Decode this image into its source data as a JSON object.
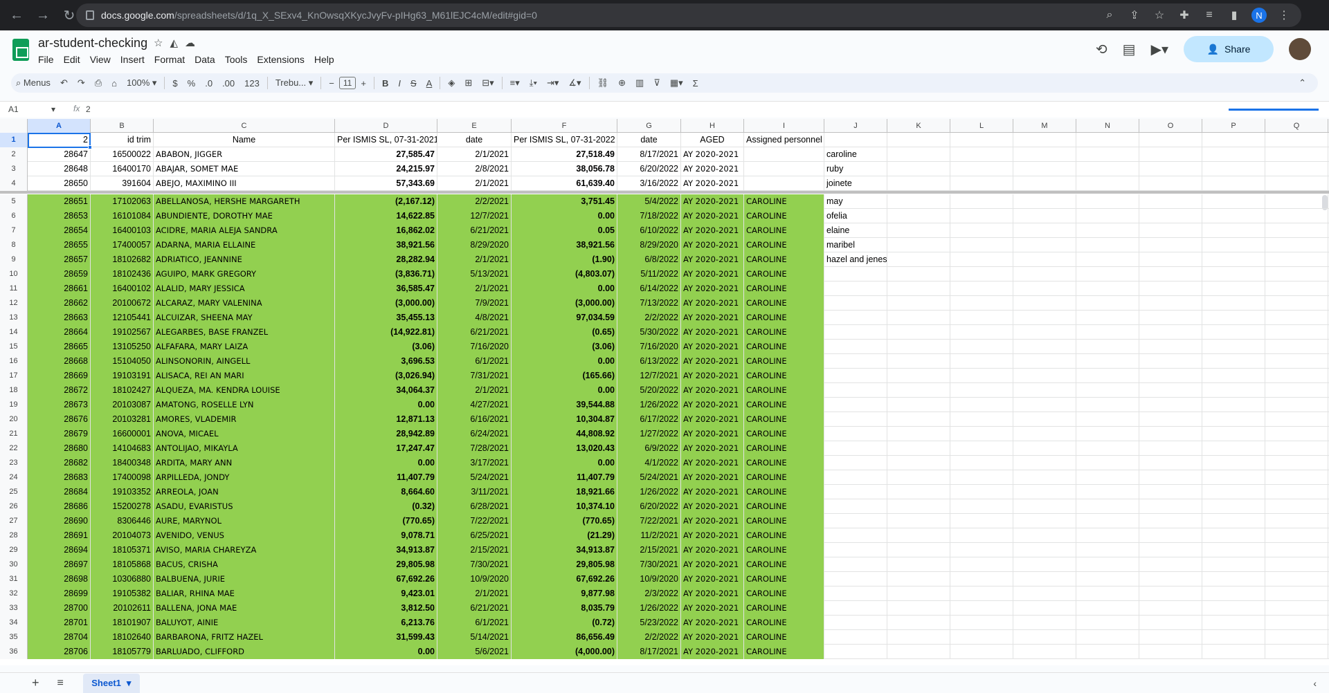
{
  "browser": {
    "url_host": "docs.google.com",
    "url_path": "/spreadsheets/d/1q_X_SExv4_KnOwsqXKycJvyFv-pIHg63_M61lEJC4cM/edit#gid=0",
    "avatar_letter": "N"
  },
  "doc": {
    "title": "ar-student-checking",
    "menus": [
      "File",
      "Edit",
      "View",
      "Insert",
      "Format",
      "Data",
      "Tools",
      "Extensions",
      "Help"
    ],
    "share_label": "Share"
  },
  "toolbar": {
    "search_label": "Menus",
    "zoom": "100%",
    "currency": "$",
    "percent": "%",
    "dec_less": ".0",
    "dec_more": ".00",
    "format_123": "123",
    "font": "Trebu...",
    "font_size": "11",
    "bold": "B",
    "italic": "I",
    "strike": "S",
    "textcolor": "A"
  },
  "formula_bar": {
    "cell_ref": "A1",
    "fx": "fx",
    "value": "2"
  },
  "columns": [
    "A",
    "B",
    "C",
    "D",
    "E",
    "F",
    "G",
    "H",
    "I",
    "J",
    "K",
    "L",
    "M",
    "N",
    "O",
    "P",
    "Q"
  ],
  "header_row": [
    "2",
    "id trim",
    "Name",
    "Per ISMIS SL, 07-31-2021",
    "date",
    "Per ISMIS SL, 07-31-2022",
    "date",
    "AGED",
    "Assigned personnel",
    "",
    "",
    "",
    "",
    "",
    "",
    "",
    ""
  ],
  "rows": [
    [
      "28647",
      "16500022",
      "ABABON, JIGGER",
      "27,585.47",
      "2/1/2021",
      "27,518.49",
      "8/17/2021",
      "AY 2020-2021",
      "",
      "caroline"
    ],
    [
      "28648",
      "16400170",
      "ABAJAR, SOMET MAE",
      "24,215.97",
      "2/8/2021",
      "38,056.78",
      "6/20/2022",
      "AY 2020-2021",
      "",
      "ruby"
    ],
    [
      "28650",
      "391604",
      "ABEJO, MAXIMINO III",
      "57,343.69",
      "2/1/2021",
      "61,639.40",
      "3/16/2022",
      "AY 2020-2021",
      "",
      "joinete"
    ],
    [
      "28651",
      "17102063",
      "ABELLANOSA, HERSHE MARGARETH",
      "(2,167.12)",
      "2/2/2021",
      "3,751.45",
      "5/4/2022",
      "AY 2020-2021",
      "CAROLINE",
      "may"
    ],
    [
      "28653",
      "16101084",
      "ABUNDIENTE, DOROTHY MAE",
      "14,622.85",
      "12/7/2021",
      "0.00",
      "7/18/2022",
      "AY 2020-2021",
      "CAROLINE",
      "ofelia"
    ],
    [
      "28654",
      "16400103",
      "ACIDRE, MARIA ALEJA SANDRA",
      "16,862.02",
      "6/21/2021",
      "0.05",
      "6/10/2022",
      "AY 2020-2021",
      "CAROLINE",
      "elaine"
    ],
    [
      "28655",
      "17400057",
      "ADARNA, MARIA ELLAINE",
      "38,921.56",
      "8/29/2020",
      "38,921.56",
      "8/29/2020",
      "AY 2020-2021",
      "CAROLINE",
      "maribel"
    ],
    [
      "28657",
      "18102682",
      "ADRIATICO, JEANNINE",
      "28,282.94",
      "2/1/2021",
      "(1.90)",
      "6/8/2022",
      "AY 2020-2021",
      "CAROLINE",
      "hazel and jenesel"
    ],
    [
      "28659",
      "18102436",
      "AGUIPO, MARK GREGORY",
      "(3,836.71)",
      "5/13/2021",
      "(4,803.07)",
      "5/11/2022",
      "AY 2020-2021",
      "CAROLINE",
      ""
    ],
    [
      "28661",
      "16400102",
      "ALALID, MARY JESSICA",
      "36,585.47",
      "2/1/2021",
      "0.00",
      "6/14/2022",
      "AY 2020-2021",
      "CAROLINE",
      ""
    ],
    [
      "28662",
      "20100672",
      "ALCARAZ, MARY VALENINA",
      "(3,000.00)",
      "7/9/2021",
      "(3,000.00)",
      "7/13/2022",
      "AY 2020-2021",
      "CAROLINE",
      ""
    ],
    [
      "28663",
      "12105441",
      "ALCUIZAR, SHEENA MAY",
      "35,455.13",
      "4/8/2021",
      "97,034.59",
      "2/2/2022",
      "AY 2020-2021",
      "CAROLINE",
      ""
    ],
    [
      "28664",
      "19102567",
      "ALEGARBES, BASE FRANZEL",
      "(14,922.81)",
      "6/21/2021",
      "(0.65)",
      "5/30/2022",
      "AY 2020-2021",
      "CAROLINE",
      ""
    ],
    [
      "28665",
      "13105250",
      "ALFAFARA, MARY LAIZA",
      "(3.06)",
      "7/16/2020",
      "(3.06)",
      "7/16/2020",
      "AY 2020-2021",
      "CAROLINE",
      ""
    ],
    [
      "28668",
      "15104050",
      "ALINSONORIN, AINGELL",
      "3,696.53",
      "6/1/2021",
      "0.00",
      "6/13/2022",
      "AY 2020-2021",
      "CAROLINE",
      ""
    ],
    [
      "28669",
      "19103191",
      "ALISACA, REI AN MARI",
      "(3,026.94)",
      "7/31/2021",
      "(165.66)",
      "12/7/2021",
      "AY 2020-2021",
      "CAROLINE",
      ""
    ],
    [
      "28672",
      "18102427",
      "ALQUEZA, MA. KENDRA LOUISE",
      "34,064.37",
      "2/1/2021",
      "0.00",
      "5/20/2022",
      "AY 2020-2021",
      "CAROLINE",
      ""
    ],
    [
      "28673",
      "20103087",
      "AMATONG, ROSELLE LYN",
      "0.00",
      "4/27/2021",
      "39,544.88",
      "1/26/2022",
      "AY 2020-2021",
      "CAROLINE",
      ""
    ],
    [
      "28676",
      "20103281",
      "AMORES, VLADEMIR",
      "12,871.13",
      "6/16/2021",
      "10,304.87",
      "6/17/2022",
      "AY 2020-2021",
      "CAROLINE",
      ""
    ],
    [
      "28679",
      "16600001",
      "ANOVA, MICAEL",
      "28,942.89",
      "6/24/2021",
      "44,808.92",
      "1/27/2022",
      "AY 2020-2021",
      "CAROLINE",
      ""
    ],
    [
      "28680",
      "14104683",
      "ANTOLIJAO, MIKAYLA",
      "17,247.47",
      "7/28/2021",
      "13,020.43",
      "6/9/2022",
      "AY 2020-2021",
      "CAROLINE",
      ""
    ],
    [
      "28682",
      "18400348",
      "ARDITA, MARY ANN",
      "0.00",
      "3/17/2021",
      "0.00",
      "4/1/2022",
      "AY 2020-2021",
      "CAROLINE",
      ""
    ],
    [
      "28683",
      "17400098",
      "ARPILLEDA, JONDY",
      "11,407.79",
      "5/24/2021",
      "11,407.79",
      "5/24/2021",
      "AY 2020-2021",
      "CAROLINE",
      ""
    ],
    [
      "28684",
      "19103352",
      "ARREOLA, JOAN",
      "8,664.60",
      "3/11/2021",
      "18,921.66",
      "1/26/2022",
      "AY 2020-2021",
      "CAROLINE",
      ""
    ],
    [
      "28686",
      "15200278",
      "ASADU, EVARISTUS",
      "(0.32)",
      "6/28/2021",
      "10,374.10",
      "6/20/2022",
      "AY 2020-2021",
      "CAROLINE",
      ""
    ],
    [
      "28690",
      "8306446",
      "AURE, MARYNOL",
      "(770.65)",
      "7/22/2021",
      "(770.65)",
      "7/22/2021",
      "AY 2020-2021",
      "CAROLINE",
      ""
    ],
    [
      "28691",
      "20104073",
      "AVENIDO, VENUS",
      "9,078.71",
      "6/25/2021",
      "(21.29)",
      "11/2/2021",
      "AY 2020-2021",
      "CAROLINE",
      ""
    ],
    [
      "28694",
      "18105371",
      "AVISO, MARIA CHAREYZA",
      "34,913.87",
      "2/15/2021",
      "34,913.87",
      "2/15/2021",
      "AY 2020-2021",
      "CAROLINE",
      ""
    ],
    [
      "28697",
      "18105868",
      "BACUS, CRISHA",
      "29,805.98",
      "7/30/2021",
      "29,805.98",
      "7/30/2021",
      "AY 2020-2021",
      "CAROLINE",
      ""
    ],
    [
      "28698",
      "10306880",
      "BALBUENA, JURIE",
      "67,692.26",
      "10/9/2020",
      "67,692.26",
      "10/9/2020",
      "AY 2020-2021",
      "CAROLINE",
      ""
    ],
    [
      "28699",
      "19105382",
      "BALIAR, RHINA MAE",
      "9,423.01",
      "2/1/2021",
      "9,877.98",
      "2/3/2022",
      "AY 2020-2021",
      "CAROLINE",
      ""
    ],
    [
      "28700",
      "20102611",
      "BALLENA, JONA MAE",
      "3,812.50",
      "6/21/2021",
      "8,035.79",
      "1/26/2022",
      "AY 2020-2021",
      "CAROLINE",
      ""
    ],
    [
      "28701",
      "18101907",
      "BALUYOT, AINIE",
      "6,213.76",
      "6/1/2021",
      "(0.72)",
      "5/23/2022",
      "AY 2020-2021",
      "CAROLINE",
      ""
    ],
    [
      "28704",
      "18102640",
      "BARBARONA, FRITZ HAZEL",
      "31,599.43",
      "5/14/2021",
      "86,656.49",
      "2/2/2022",
      "AY 2020-2021",
      "CAROLINE",
      ""
    ],
    [
      "28706",
      "18105779",
      "BARLUADO, CLIFFORD",
      "0.00",
      "5/6/2021",
      "(4,000.00)",
      "8/17/2021",
      "AY 2020-2021",
      "CAROLINE",
      ""
    ]
  ],
  "sheet": {
    "tab_name": "Sheet1"
  }
}
